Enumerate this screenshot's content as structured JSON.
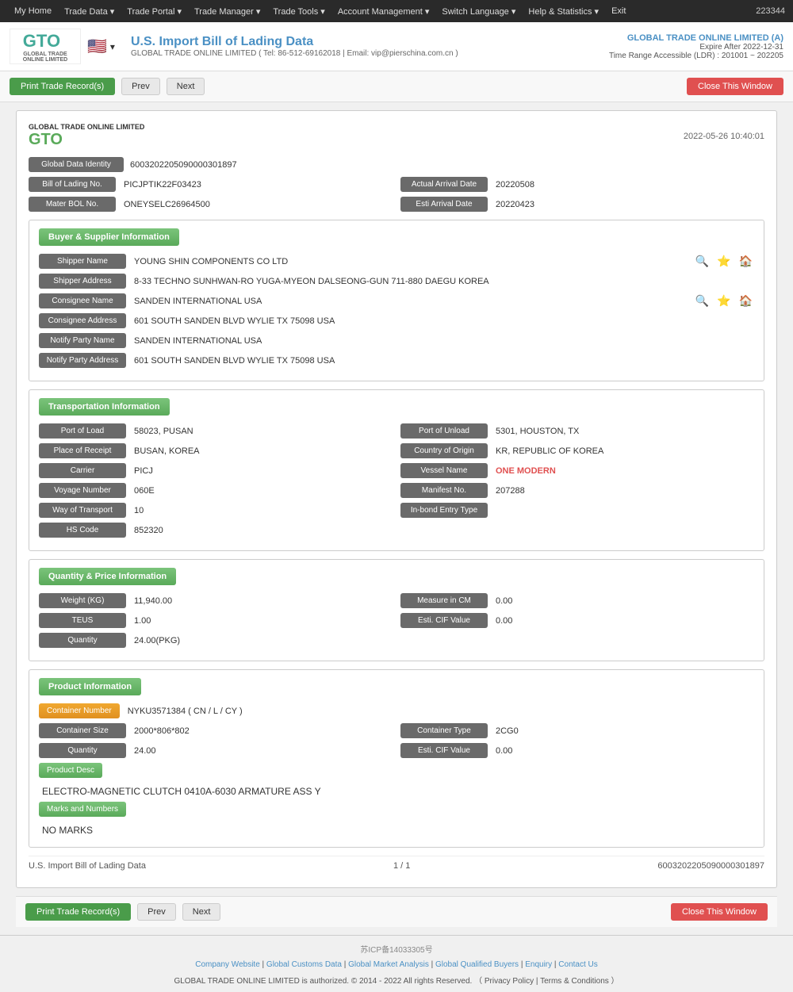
{
  "nav": {
    "items": [
      "My Home",
      "Trade Data",
      "Trade Portal",
      "Trade Manager",
      "Trade Tools",
      "Account Management",
      "Switch Language",
      "Help & Statistics",
      "Exit"
    ],
    "user_id": "223344"
  },
  "header": {
    "title": "U.S. Import Bill of Lading Data",
    "subtitle": "GLOBAL TRADE ONLINE LIMITED ( Tel: 86-512-69162018  | Email: vip@pierschina.com.cn )",
    "company": "GLOBAL TRADE ONLINE LIMITED (A)",
    "expire": "Expire After 2022-12-31",
    "time_range": "Time Range Accessible (LDR) : 201001 ~ 202205"
  },
  "toolbar": {
    "print_label": "Print Trade Record(s)",
    "prev_label": "Prev",
    "next_label": "Next",
    "close_label": "Close This Window"
  },
  "card": {
    "timestamp": "2022-05-26 10:40:01",
    "global_data_identity_label": "Global Data Identity",
    "global_data_identity_value": "6003202205090000301897",
    "bill_of_lading_label": "Bill of Lading No.",
    "bill_of_lading_value": "PICJPTIK22F03423",
    "actual_arrival_label": "Actual Arrival Date",
    "actual_arrival_value": "20220508",
    "master_bol_label": "Mater BOL No.",
    "master_bol_value": "ONEYSELC26964500",
    "esti_arrival_label": "Esti Arrival Date",
    "esti_arrival_value": "20220423"
  },
  "buyer_supplier": {
    "section_title": "Buyer & Supplier Information",
    "shipper_name_label": "Shipper Name",
    "shipper_name_value": "YOUNG SHIN COMPONENTS CO LTD",
    "shipper_address_label": "Shipper Address",
    "shipper_address_value": "8-33 TECHNO SUNHWAN-RO YUGA-MYEON DALSEONG-GUN 711-880 DAEGU KOREA",
    "consignee_name_label": "Consignee Name",
    "consignee_name_value": "SANDEN INTERNATIONAL USA",
    "consignee_address_label": "Consignee Address",
    "consignee_address_value": "601 SOUTH SANDEN BLVD WYLIE TX 75098 USA",
    "notify_party_name_label": "Notify Party Name",
    "notify_party_name_value": "SANDEN INTERNATIONAL USA",
    "notify_party_address_label": "Notify Party Address",
    "notify_party_address_value": "601 SOUTH SANDEN BLVD WYLIE TX 75098 USA"
  },
  "transportation": {
    "section_title": "Transportation Information",
    "port_of_load_label": "Port of Load",
    "port_of_load_value": "58023, PUSAN",
    "port_of_unload_label": "Port of Unload",
    "port_of_unload_value": "5301, HOUSTON, TX",
    "place_of_receipt_label": "Place of Receipt",
    "place_of_receipt_value": "BUSAN, KOREA",
    "country_of_origin_label": "Country of Origin",
    "country_of_origin_value": "KR, REPUBLIC OF KOREA",
    "carrier_label": "Carrier",
    "carrier_value": "PICJ",
    "vessel_name_label": "Vessel Name",
    "vessel_name_value": "ONE MODERN",
    "voyage_number_label": "Voyage Number",
    "voyage_number_value": "060E",
    "manifest_no_label": "Manifest No.",
    "manifest_no_value": "207288",
    "way_of_transport_label": "Way of Transport",
    "way_of_transport_value": "10",
    "in_bond_entry_label": "In-bond Entry Type",
    "in_bond_entry_value": "",
    "hs_code_label": "HS Code",
    "hs_code_value": "852320"
  },
  "quantity_price": {
    "section_title": "Quantity & Price Information",
    "weight_label": "Weight (KG)",
    "weight_value": "11,940.00",
    "measure_in_cm_label": "Measure in CM",
    "measure_in_cm_value": "0.00",
    "teus_label": "TEUS",
    "teus_value": "1.00",
    "esti_cif_label": "Esti. CIF Value",
    "esti_cif_value": "0.00",
    "quantity_label": "Quantity",
    "quantity_value": "24.00(PKG)"
  },
  "product": {
    "section_title": "Product Information",
    "container_number_label": "Container Number",
    "container_number_value": "NYKU3571384 ( CN / L / CY )",
    "container_size_label": "Container Size",
    "container_size_value": "2000*806*802",
    "container_type_label": "Container Type",
    "container_type_value": "2CG0",
    "quantity_label": "Quantity",
    "quantity_value": "24.00",
    "esti_cif_label": "Esti. CIF Value",
    "esti_cif_value": "0.00",
    "product_desc_label": "Product Desc",
    "product_desc_value": "ELECTRO-MAGNETIC CLUTCH 0410A-6030 ARMATURE ASS Y",
    "marks_label": "Marks and Numbers",
    "marks_value": "NO MARKS"
  },
  "page_footer": {
    "source": "U.S. Import Bill of Lading Data",
    "pagination": "1 / 1",
    "record_id": "6003202205090000301897"
  },
  "footer": {
    "icp": "苏ICP备14033305号",
    "links": [
      "Company Website",
      "Global Customs Data",
      "Global Market Analysis",
      "Global Qualified Buyers",
      "Enquiry",
      "Contact Us"
    ],
    "copyright": "GLOBAL TRADE ONLINE LIMITED is authorized. © 2014 - 2022 All rights Reserved.  （ Privacy Policy | Terms & Conditions ）"
  }
}
